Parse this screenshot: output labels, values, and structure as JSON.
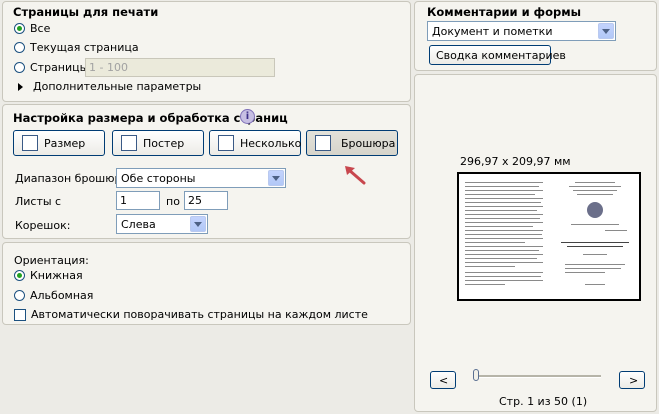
{
  "print_pages": {
    "title": "Страницы для печати",
    "all": "Все",
    "current": "Текущая страница",
    "pages": "Страницы",
    "range_value": "1 - 100",
    "more": "Дополнительные параметры"
  },
  "sizing": {
    "title": "Настройка размера и обработка страниц",
    "buttons": [
      "Размер",
      "Постер",
      "Несколько",
      "Брошюра"
    ],
    "booklet_range_label": "Диапазон брошюры:",
    "booklet_range_value": "Обе стороны",
    "sheets_label": "Листы с",
    "sheets_from": "1",
    "sheets_to_label": "по",
    "sheets_to": "25",
    "binding_label": "Корешок:",
    "binding_value": "Слева"
  },
  "orientation": {
    "title": "Ориентация:",
    "portrait": "Книжная",
    "landscape": "Альбомная",
    "auto_rotate": "Автоматически поворачивать страницы на каждом листе"
  },
  "comments": {
    "title": "Комментарии и формы",
    "select_value": "Документ и пометки",
    "summary_button": "Сводка комментариев"
  },
  "preview": {
    "dimensions": "296,97 x 209,97 мм",
    "prev": "<",
    "next": ">",
    "page_status": "Стр. 1 из 50 (1)"
  },
  "colors": {
    "accent_arrow": "#c8474e",
    "radio_dot": "#21a121"
  }
}
